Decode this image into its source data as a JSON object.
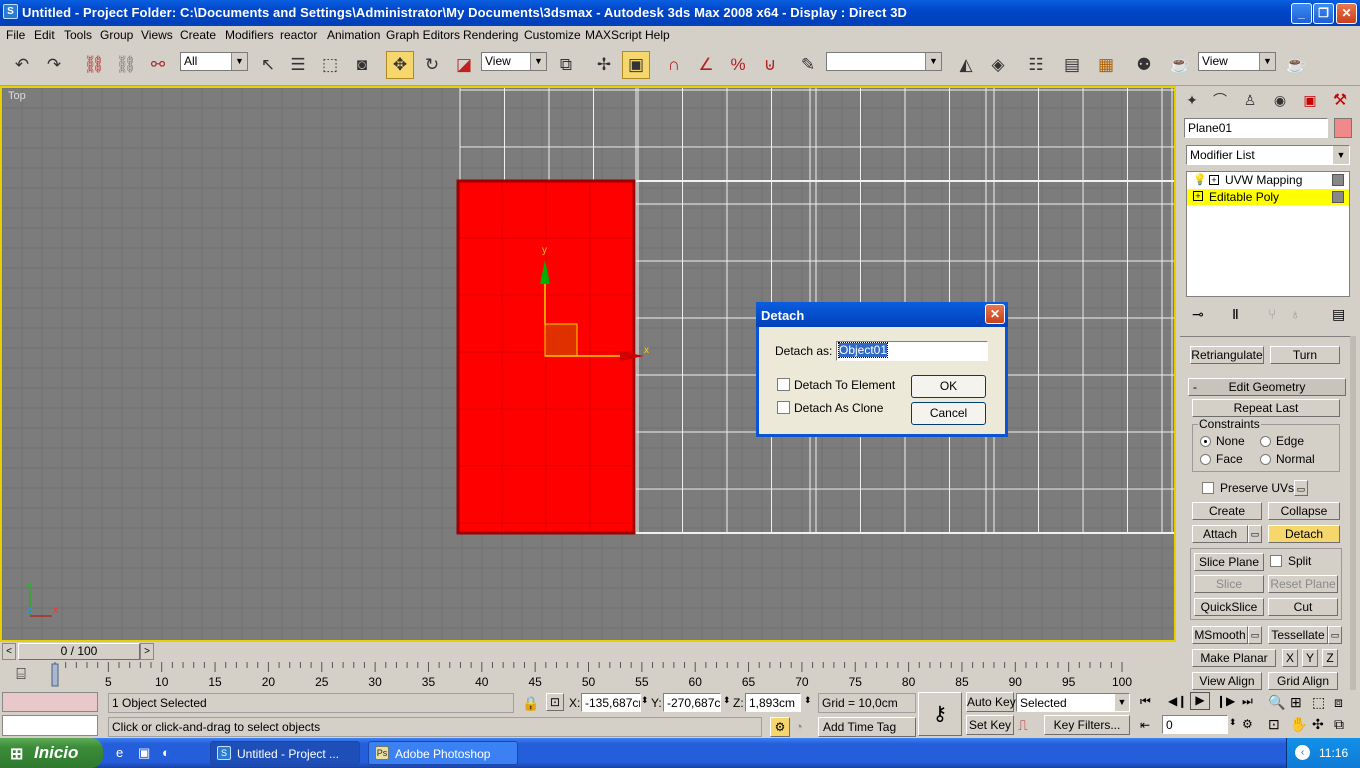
{
  "window": {
    "title": "Untitled     - Project Folder: C:\\Documents and Settings\\Administrator\\My Documents\\3dsmax      - Autodesk 3ds Max 2008 x64      - Display : Direct 3D",
    "min": "_",
    "max": "❐",
    "close": "✕"
  },
  "menu": [
    "File",
    "Edit",
    "Tools",
    "Group",
    "Views",
    "Create",
    "Modifiers",
    "reactor",
    "Animation",
    "Graph Editors",
    "Rendering",
    "Customize",
    "MAXScript",
    "Help"
  ],
  "toolbar": {
    "selection_filter": "All",
    "ref_coord": "View",
    "named_sel": "",
    "render_view": "View"
  },
  "viewport": {
    "label": "Top",
    "axis_y": "y",
    "axis_x": "x",
    "mini_y": "y",
    "mini_z": "z",
    "mini_x": "x",
    "object_color": "#ff0000",
    "bg_color": "#7c7c7c"
  },
  "command_panel": {
    "object_name": "Plane01",
    "object_color": "#f08a8a",
    "modifier_list": "Modifier List",
    "stack": [
      "UVW Mapping",
      "Editable Poly"
    ],
    "retriangulate": "Retriangulate",
    "turn": "Turn",
    "rollout_minus": "-",
    "rollout_title": "Edit Geometry",
    "repeat_last": "Repeat Last",
    "constraints": "Constraints",
    "none": "None",
    "edge": "Edge",
    "face": "Face",
    "normal": "Normal",
    "preserve_uvs": "Preserve UVs",
    "create": "Create",
    "collapse": "Collapse",
    "attach": "Attach",
    "detach": "Detach",
    "slice_plane": "Slice Plane",
    "split": "Split",
    "slice": "Slice",
    "reset_plane": "Reset Plane",
    "quickslice": "QuickSlice",
    "cut": "Cut",
    "msmooth": "MSmooth",
    "tessellate": "Tessellate",
    "make_planar": "Make Planar",
    "x": "X",
    "y": "Y",
    "z": "Z",
    "view_align": "View Align",
    "grid_align": "Grid Align"
  },
  "dialog": {
    "title": "Detach",
    "detach_as_label": "Detach as:",
    "detach_as_value": "Object01",
    "to_element": "Detach To Element",
    "as_clone": "Detach As Clone",
    "ok": "OK",
    "cancel": "Cancel"
  },
  "timeline": {
    "frame": "0 / 100",
    "ticks": [
      "0",
      "5",
      "10",
      "15",
      "20",
      "25",
      "30",
      "35",
      "40",
      "45",
      "50",
      "55",
      "60",
      "65",
      "70",
      "75",
      "80",
      "85",
      "90",
      "95",
      "100"
    ]
  },
  "status": {
    "selected": "1 Object Selected",
    "prompt": "Click or click-and-drag to select objects",
    "x_label": "X:",
    "x": "-135,687cr",
    "y_label": "Y:",
    "y": "-270,687cr",
    "z_label": "Z:",
    "z": "1,893cm",
    "grid": "Grid = 10,0cm",
    "add_time_tag": "Add Time Tag",
    "auto_key": "Auto Key",
    "set_key": "Set Key",
    "key_mode": "Selected",
    "key_filters": "Key Filters...",
    "frame_value": "0"
  },
  "taskbar": {
    "start": "Inicio",
    "tasks": [
      "Untitled      - Project ...",
      "Adobe Photoshop"
    ],
    "clock": "11:16"
  }
}
